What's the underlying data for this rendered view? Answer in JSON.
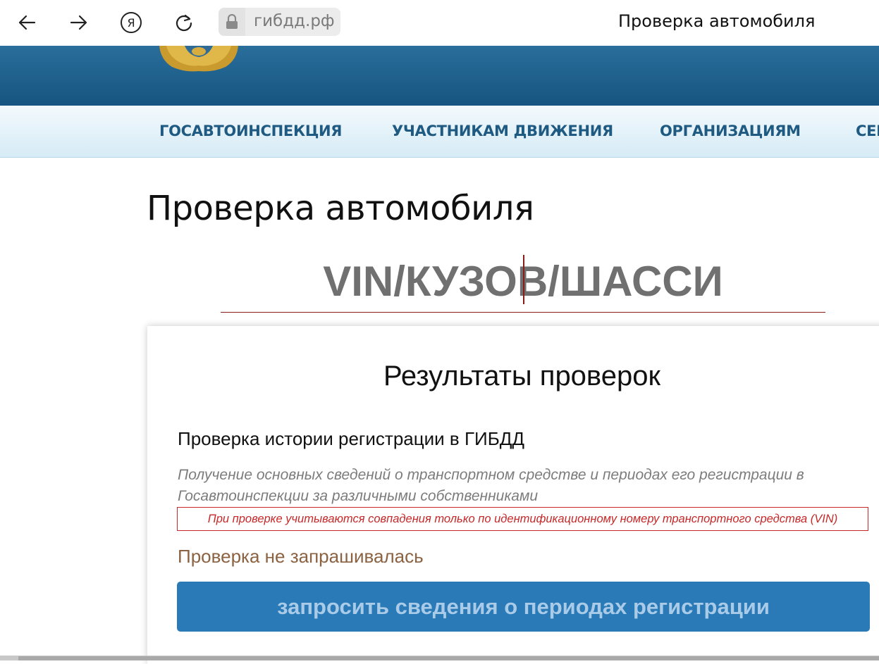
{
  "browser": {
    "url": "гибдд.рф",
    "tab_title": "Проверка автомобиля",
    "yandex_glyph": "Я"
  },
  "nav": {
    "items": [
      {
        "label": "ГОСАВТОИНСПЕКЦИЯ"
      },
      {
        "label": "УЧАСТНИКАМ ДВИЖЕНИЯ"
      },
      {
        "label": "ОРГАНИЗАЦИЯМ"
      },
      {
        "label": "СЕР"
      }
    ]
  },
  "page": {
    "title": "Проверка автомобиля",
    "vin_placeholder": "VIN/КУЗОВ/ШАССИ"
  },
  "results": {
    "title": "Результаты проверок",
    "check_title": "Проверка истории регистрации в ГИБДД",
    "check_description": "Получение основных сведений о транспортном средстве и периодах его регистрации в Госавтоинспекции за различными собственниками",
    "notice": "При проверке учитываются совпадения только по идентификационному номеру транспортного средства (VIN)",
    "status": "Проверка не запрашивалась",
    "button_label": "запросить сведения о периодах регистрации"
  },
  "colors": {
    "header_blue": "#1b5d88",
    "nav_text": "#1e5a82",
    "button_blue": "#2a7ab8",
    "notice_red": "#c62828",
    "status_brown": "#8b6242"
  }
}
